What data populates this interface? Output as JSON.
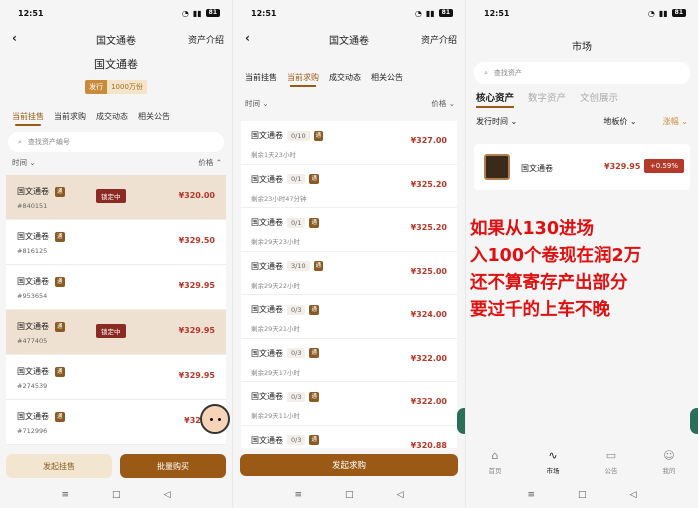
{
  "status": {
    "time": "12:51",
    "battery": "81"
  },
  "p1": {
    "nav_title": "国文通卷",
    "nav_right": "资产介绍",
    "hero_title": "国文通卷",
    "badge_label": "发行",
    "badge_value": "1000万份",
    "tabs": [
      "当前挂售",
      "当前求购",
      "成交动态",
      "相关公告"
    ],
    "search_placeholder": "查找资产编号",
    "sort_left": "时间",
    "sort_right": "价格",
    "rows": [
      {
        "name": "国文通卷",
        "tag": "通",
        "id": "#840151",
        "price": "¥320.00",
        "lock": "锁定中"
      },
      {
        "name": "国文通卷",
        "tag": "通",
        "id": "#816125",
        "price": "¥329.50",
        "lock": ""
      },
      {
        "name": "国文通卷",
        "tag": "通",
        "id": "#953654",
        "price": "¥329.95",
        "lock": ""
      },
      {
        "name": "国文通卷",
        "tag": "通",
        "id": "#477405",
        "price": "¥329.95",
        "lock": "锁定中"
      },
      {
        "name": "国文通卷",
        "tag": "通",
        "id": "#274539",
        "price": "¥329.95",
        "lock": ""
      },
      {
        "name": "国文通卷",
        "tag": "通",
        "id": "#712996",
        "price": "¥329.9",
        "lock": ""
      }
    ],
    "btn_left": "发起挂售",
    "btn_right": "批量购买"
  },
  "p2": {
    "nav_title": "国文通卷",
    "nav_right": "资产介绍",
    "tabs": [
      "当前挂售",
      "当前求购",
      "成交动态",
      "相关公告"
    ],
    "sort_left": "时间",
    "sort_right": "价格",
    "rows": [
      {
        "name": "国文通卷",
        "count": "0/10",
        "tag": "通",
        "remain": "剩余1天23小时",
        "price": "¥327.00"
      },
      {
        "name": "国文通卷",
        "count": "0/1",
        "tag": "通",
        "remain": "剩余23小时47分钟",
        "price": "¥325.20"
      },
      {
        "name": "国文通卷",
        "count": "0/1",
        "tag": "通",
        "remain": "剩余29天23小时",
        "price": "¥325.20"
      },
      {
        "name": "国文通卷",
        "count": "3/10",
        "tag": "通",
        "remain": "剩余29天22小时",
        "price": "¥325.00"
      },
      {
        "name": "国文通卷",
        "count": "0/3",
        "tag": "通",
        "remain": "剩余29天21小时",
        "price": "¥324.00"
      },
      {
        "name": "国文通卷",
        "count": "0/3",
        "tag": "通",
        "remain": "剩余29天17小时",
        "price": "¥322.00"
      },
      {
        "name": "国文通卷",
        "count": "0/3",
        "tag": "通",
        "remain": "剩余29天11小时",
        "price": "¥322.00"
      },
      {
        "name": "国文通卷",
        "count": "0/3",
        "tag": "通",
        "remain": "",
        "price": "¥320.88"
      }
    ],
    "btn": "发起求购"
  },
  "p3": {
    "title": "市场",
    "search_placeholder": "查找资产",
    "categories": [
      "核心资产",
      "数字资产",
      "文创展示"
    ],
    "filter_left": "发行时间",
    "filter_mid": "地板价",
    "filter_right": "涨幅",
    "card": {
      "name": "国文通卷",
      "price": "¥329.95",
      "change": "+0.59%"
    },
    "overlay": [
      "如果从130进场",
      "入100个卷现在润2万",
      "还不算寄存产出部分",
      "要过千的上车不晚"
    ],
    "tabbar": [
      "首页",
      "市场",
      "公告",
      "我的"
    ]
  }
}
